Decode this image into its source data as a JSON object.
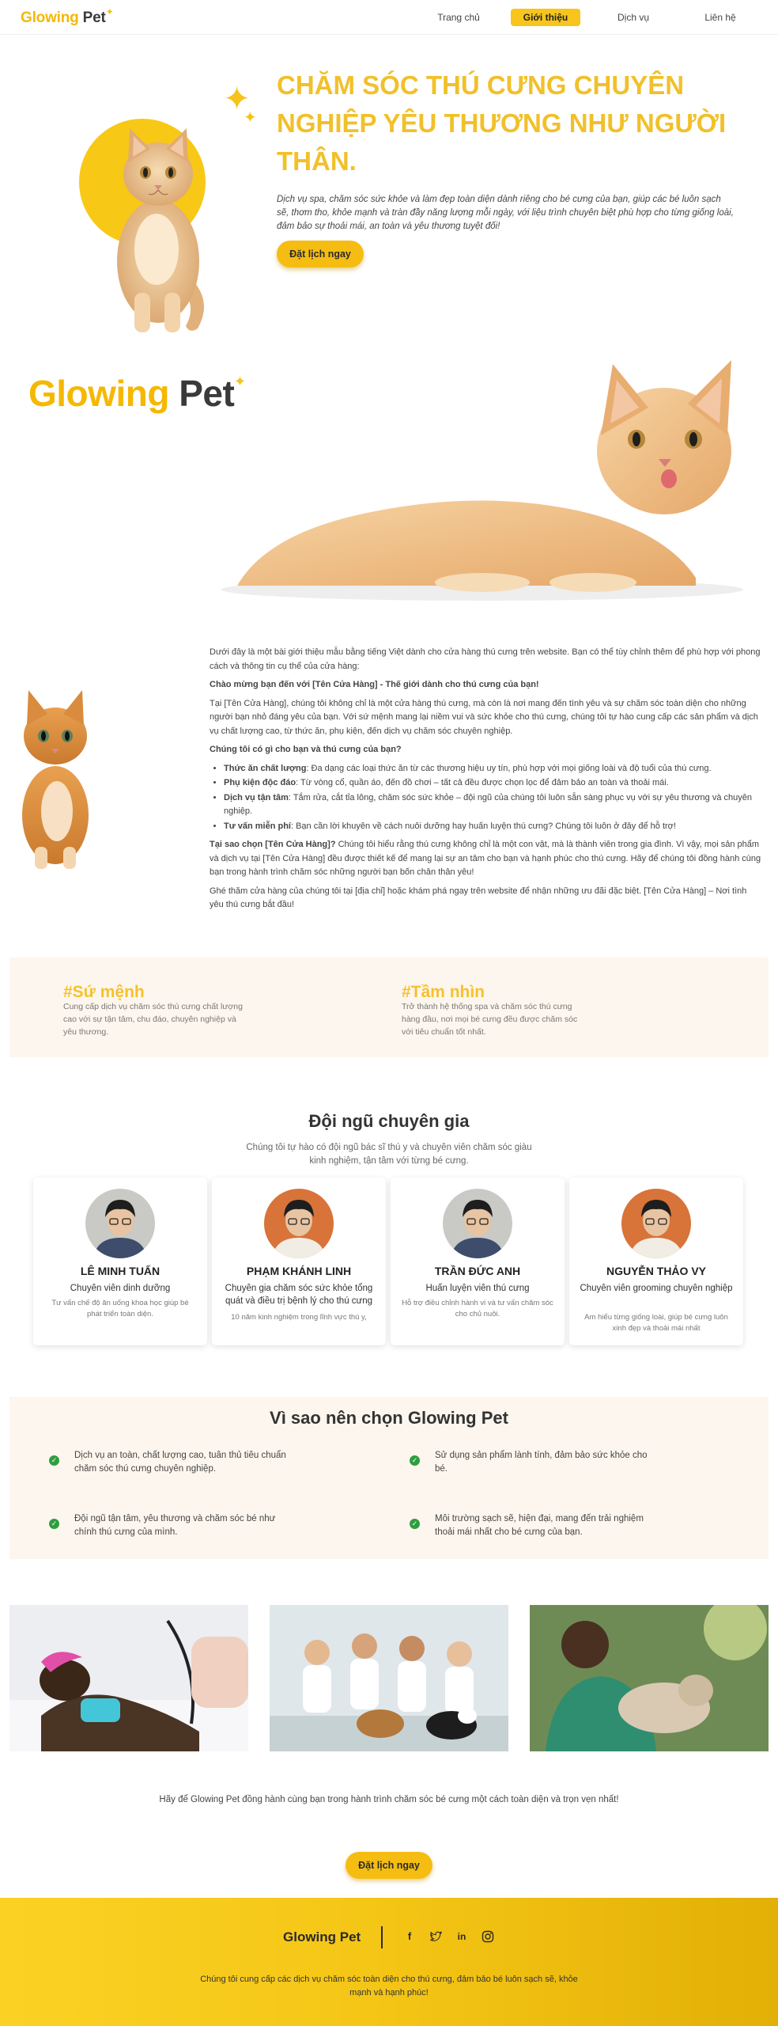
{
  "nav": {
    "brand_part1": "Glowing",
    "brand_part2": "Pet",
    "items": [
      {
        "label": "Trang chủ",
        "active": false
      },
      {
        "label": "Giới thiệu",
        "active": true
      },
      {
        "label": "Dịch vụ",
        "active": false
      },
      {
        "label": "Liên hệ",
        "active": false
      }
    ]
  },
  "hero": {
    "title": "CHĂM SÓC THÚ CƯNG CHUYÊN NGHIỆP YÊU THƯƠNG NHƯ NGƯỜI THÂN.",
    "description": "Dịch vụ spa, chăm sóc sức khỏe và làm đẹp toàn diện dành riêng cho bé cưng của bạn, giúp các bé luôn sạch sẽ, thơm tho, khỏe mạnh và tràn đầy năng lượng mỗi ngày, với liệu trình chuyên biệt phù hợp cho từng giống loài, đảm bảo sự thoải mái, an toàn và yêu thương tuyệt đối!",
    "cta": "Đặt lịch ngay"
  },
  "banner": {
    "brand_part1": "Glowing",
    "brand_part2": "Pet"
  },
  "article": {
    "intro": "Dưới đây là một bài giới thiệu mẫu bằng tiếng Việt dành cho cửa hàng thú cưng trên website. Bạn có thể tùy chỉnh thêm để phù hợp với phong cách và thông tin cụ thể của cửa hàng:",
    "welcome": "Chào mừng bạn đến với [Tên Cửa Hàng] - Thế giới dành cho thú cưng của bạn!",
    "para1": "Tại [Tên Cửa Hàng], chúng tôi không chỉ là một cửa hàng thú cưng, mà còn là nơi mang đến tình yêu và sự chăm sóc toàn diện cho những người bạn nhỏ đáng yêu của bạn. Với sứ mệnh mang lại niềm vui và sức khỏe cho thú cưng, chúng tôi tự hào cung cấp các sản phẩm và dịch vụ chất lượng cao, từ thức ăn, phụ kiện, đến dịch vụ chăm sóc chuyên nghiệp.",
    "offer_heading": "Chúng tôi có gì cho bạn và thú cưng của bạn?",
    "offers": [
      {
        "label": "Thức ăn chất lượng",
        "text": ": Đa dạng các loại thức ăn từ các thương hiệu uy tín, phù hợp với mọi giống loài và độ tuổi của thú cưng."
      },
      {
        "label": "Phụ kiện độc đáo",
        "text": ": Từ vòng cổ, quần áo, đến đồ chơi – tất cả đều được chọn lọc để đảm bảo an toàn và thoải mái."
      },
      {
        "label": "Dịch vụ tận tâm",
        "text": ": Tắm rửa, cắt tỉa lông, chăm sóc sức khỏe – đội ngũ của chúng tôi luôn sẵn sàng phục vụ với sự yêu thương và chuyên nghiệp."
      },
      {
        "label": "Tư vấn miễn phí",
        "text": ": Bạn cần lời khuyên về cách nuôi dưỡng hay huấn luyện thú cưng? Chúng tôi luôn ở đây để hỗ trợ!"
      }
    ],
    "why_label": "Tại sao chọn [Tên Cửa Hàng]?",
    "why_text": " Chúng tôi hiểu rằng thú cưng không chỉ là một con vật, mà là thành viên trong gia đình. Vì vậy, mọi sản phẩm và dịch vụ tại [Tên Cửa Hàng] đều được thiết kế để mang lại sự an tâm cho bạn và hạnh phúc cho thú cưng. Hãy để chúng tôi đồng hành cùng bạn trong hành trình chăm sóc những người bạn bốn chân thân yêu!",
    "visit": "Ghé thăm cửa hàng của chúng tôi tại [địa chỉ] hoặc khám phá ngay trên website để nhận những ưu đãi đặc biệt. [Tên Cửa Hàng] – Nơi tình yêu thú cưng bắt đầu!"
  },
  "mission": {
    "mission_title": "#Sứ mệnh",
    "mission_text": "Cung cấp dịch vụ chăm sóc thú cưng chất lượng cao với sự tận tâm, chu đáo, chuyên nghiệp và yêu thương.",
    "vision_title": "#Tầm nhìn",
    "vision_text": "Trở thành hệ thống spa và chăm sóc thú cưng hàng đầu, nơi mọi bé cưng đều được chăm sóc với tiêu chuẩn tốt nhất."
  },
  "team": {
    "title": "Đội ngũ chuyên gia",
    "subtitle": "Chúng tôi tự hào có đội ngũ bác sĩ thú y và chuyên viên chăm sóc giàu kinh nghiệm, tận tâm với từng bé cưng.",
    "members": [
      {
        "name": "LÊ MINH TUẤN",
        "role": "Chuyên viên dinh dưỡng",
        "desc": "Tư vấn chế độ ăn uống khoa học giúp bé phát triển toàn diện.",
        "bg": "#c9c9c6"
      },
      {
        "name": "PHẠM KHÁNH LINH",
        "role": "Chuyên gia chăm sóc sức khỏe tổng quát và điều trị bệnh lý cho thú cưng",
        "desc": "10 năm kinh nghiệm trong lĩnh vực thú y,",
        "bg": "#d8733a"
      },
      {
        "name": "TRẦN ĐỨC ANH",
        "role": "Huấn luyện viên thú cưng",
        "desc": "Hỗ trợ điều chỉnh hành vi và tư vấn chăm sóc cho chủ nuôi.",
        "bg": "#c9c9c6"
      },
      {
        "name": "NGUYỄN THẢO VY",
        "role": "Chuyên viên grooming chuyên nghiệp",
        "desc": "Am hiểu từng giống loài, giúp bé cưng luôn xinh đẹp và thoải mái nhất",
        "bg": "#d8733a"
      }
    ]
  },
  "why": {
    "title": "Vì sao nên chọn Glowing Pet",
    "reasons": [
      "Dịch vụ an toàn, chất lượng cao, tuân thủ tiêu chuẩn chăm sóc thú cưng chuyên nghiệp.",
      "Sử dụng sản phẩm lành tính, đảm bảo sức khỏe cho bé.",
      "Đội ngũ tận tâm, yêu thương và chăm sóc bé như chính thú cưng của mình.",
      "Môi trường sạch sẽ, hiện đại, mang đến trải nghiệm thoải mái nhất cho bé cưng của bạn."
    ]
  },
  "closing": {
    "text": "Hãy để Glowing Pet đồng hành cùng bạn trong hành trình chăm sóc bé cưng một cách toàn diện và trọn vẹn nhất!",
    "cta": "Đặt lịch ngay"
  },
  "footer": {
    "brand": "Glowing Pet",
    "social": [
      "facebook-icon",
      "twitter-icon",
      "linkedin-icon",
      "instagram-icon"
    ],
    "text": "Chúng tôi cung cấp các dịch vụ chăm sóc toàn diện cho thú cưng, đảm bảo bé luôn sạch sẽ, khỏe mạnh và hạnh phúc!"
  },
  "colors": {
    "accent": "#f5bd12",
    "title_yellow": "#f1c02a",
    "check_green": "#2e9e3f",
    "cream": "#fdf6ee"
  }
}
